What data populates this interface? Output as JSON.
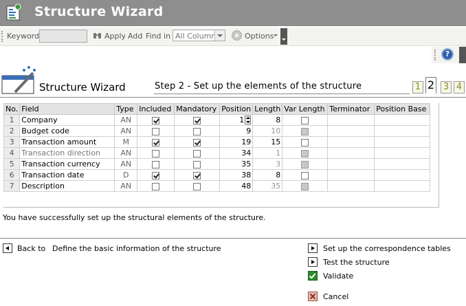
{
  "window": {
    "title": "Structure Wizard"
  },
  "toolbar": {
    "keyword_label": "Keyword",
    "keyword_value": "",
    "apply_label": "Apply",
    "add_label": "Add",
    "find_in_label": "Find in",
    "find_in_selected": "All Columns",
    "options_label": "Options"
  },
  "help": {
    "label": "?"
  },
  "wizard": {
    "title": "Structure Wizard",
    "step_title": "Step 2 - Set up the elements of the structure",
    "steps": [
      "1",
      "2",
      "3",
      "4"
    ],
    "current_step": 2
  },
  "grid": {
    "columns": [
      "No.",
      "Field",
      "Type",
      "Included",
      "Mandatory",
      "Position",
      "Length",
      "Var Length",
      "Terminator",
      "Position Base"
    ],
    "rows": [
      {
        "no": "1",
        "field": "Company",
        "type": "AN",
        "included": true,
        "mandatory": true,
        "position": "1",
        "length": "8",
        "enabled": true
      },
      {
        "no": "2",
        "field": "Budget code",
        "type": "AN",
        "included": false,
        "mandatory": false,
        "position": "9",
        "length": "10",
        "enabled": true
      },
      {
        "no": "3",
        "field": "Transaction amount",
        "type": "M",
        "included": true,
        "mandatory": true,
        "position": "19",
        "length": "15",
        "enabled": true
      },
      {
        "no": "4",
        "field": "Transaction direction",
        "type": "AN",
        "included": false,
        "mandatory": false,
        "position": "34",
        "length": "1",
        "enabled": false
      },
      {
        "no": "5",
        "field": "Transaction currency",
        "type": "AN",
        "included": false,
        "mandatory": false,
        "position": "35",
        "length": "3",
        "enabled": true
      },
      {
        "no": "6",
        "field": "Transaction date",
        "type": "D",
        "included": true,
        "mandatory": true,
        "position": "38",
        "length": "8",
        "enabled": true
      },
      {
        "no": "7",
        "field": "Description",
        "type": "AN",
        "included": false,
        "mandatory": false,
        "position": "48",
        "length": "35",
        "enabled": true
      }
    ]
  },
  "status": {
    "message": "You have successfully set up the structural elements of the structure."
  },
  "navigation": {
    "back_prefix": "Back to",
    "back_text": "Define the basic information of the structure",
    "next_correspondence": "Set up the correspondence tables",
    "test_structure": "Test the structure",
    "validate": "Validate",
    "cancel": "Cancel"
  }
}
